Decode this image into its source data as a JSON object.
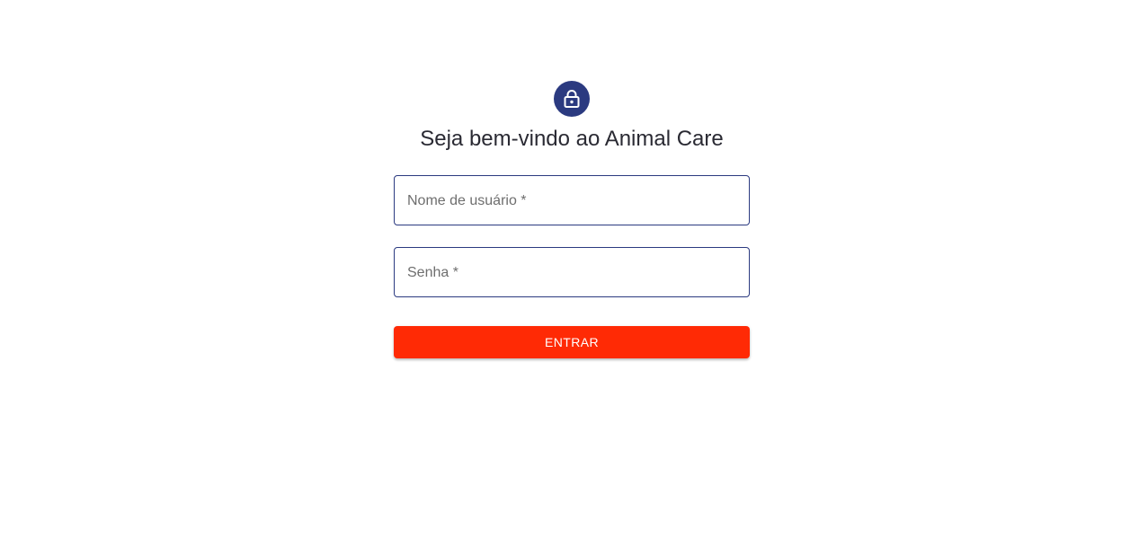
{
  "login": {
    "icon": "lock-icon",
    "title": "Seja bem-vindo ao Animal Care",
    "username": {
      "label": "Nome de usuário *",
      "value": ""
    },
    "password": {
      "label": "Senha *",
      "value": ""
    },
    "submit_label": "ENTRAR"
  },
  "colors": {
    "avatar_background": "#2b3a80",
    "field_border": "#2b3a80",
    "button_background": "#ff2a05",
    "button_text": "#ffffff",
    "title_text": "#2a2a33",
    "label_text": "#6e6e6e"
  }
}
